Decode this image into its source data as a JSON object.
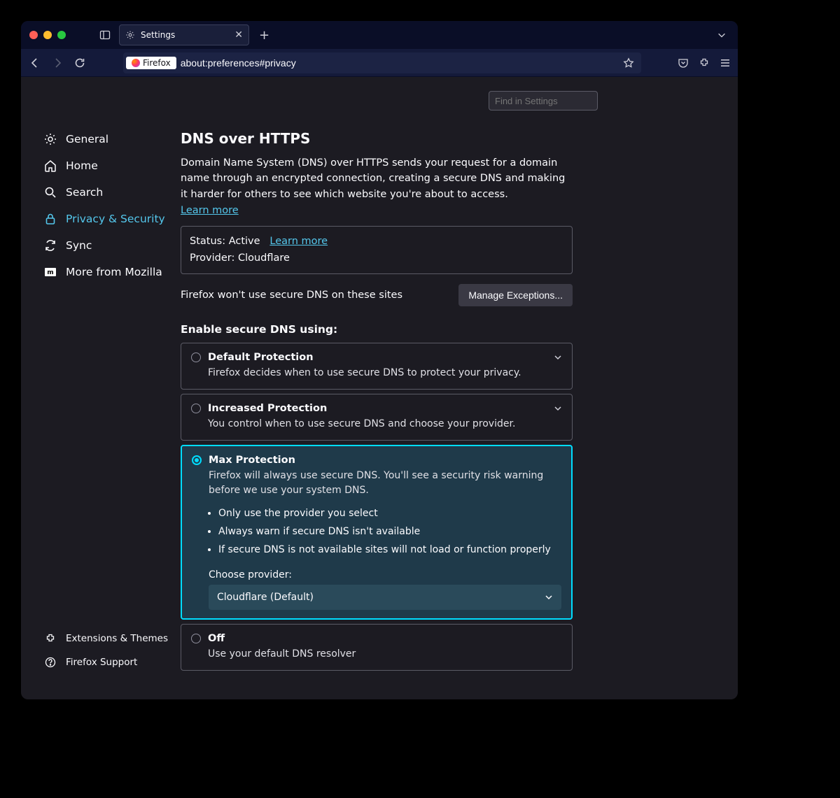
{
  "tab": {
    "title": "Settings"
  },
  "urlbar": {
    "badge": "Firefox",
    "url": "about:preferences#privacy"
  },
  "search": {
    "placeholder": "Find in Settings"
  },
  "sidebar": {
    "items": [
      {
        "label": "General"
      },
      {
        "label": "Home"
      },
      {
        "label": "Search"
      },
      {
        "label": "Privacy & Security"
      },
      {
        "label": "Sync"
      },
      {
        "label": "More from Mozilla"
      }
    ],
    "bottom": [
      {
        "label": "Extensions & Themes"
      },
      {
        "label": "Firefox Support"
      }
    ]
  },
  "section": {
    "heading": "DNS over HTTPS",
    "description": "Domain Name System (DNS) over HTTPS sends your request for a domain name through an encrypted connection, creating a secure DNS and making it harder for others to see which website you're about to access.",
    "learn_more": "Learn more",
    "status_label": "Status: ",
    "status_value": "Active",
    "status_learn_more": "Learn more",
    "provider_label": "Provider: ",
    "provider_value": "Cloudflare",
    "exceptions_text": "Firefox won't use secure DNS on these sites",
    "manage_exceptions": "Manage Exceptions...",
    "enable_heading": "Enable secure DNS using:",
    "options": [
      {
        "title": "Default Protection",
        "desc": "Firefox decides when to use secure DNS to protect your privacy."
      },
      {
        "title": "Increased Protection",
        "desc": "You control when to use secure DNS and choose your provider."
      },
      {
        "title": "Max Protection",
        "desc": "Firefox will always use secure DNS. You'll see a security risk warning before we use your system DNS.",
        "bullets": [
          "Only use the provider you select",
          "Always warn if secure DNS isn't available",
          "If secure DNS is not available sites will not load or function properly"
        ],
        "choose_label": "Choose provider:",
        "selected_provider": "Cloudflare (Default)"
      },
      {
        "title": "Off",
        "desc": "Use your default DNS resolver"
      }
    ]
  }
}
